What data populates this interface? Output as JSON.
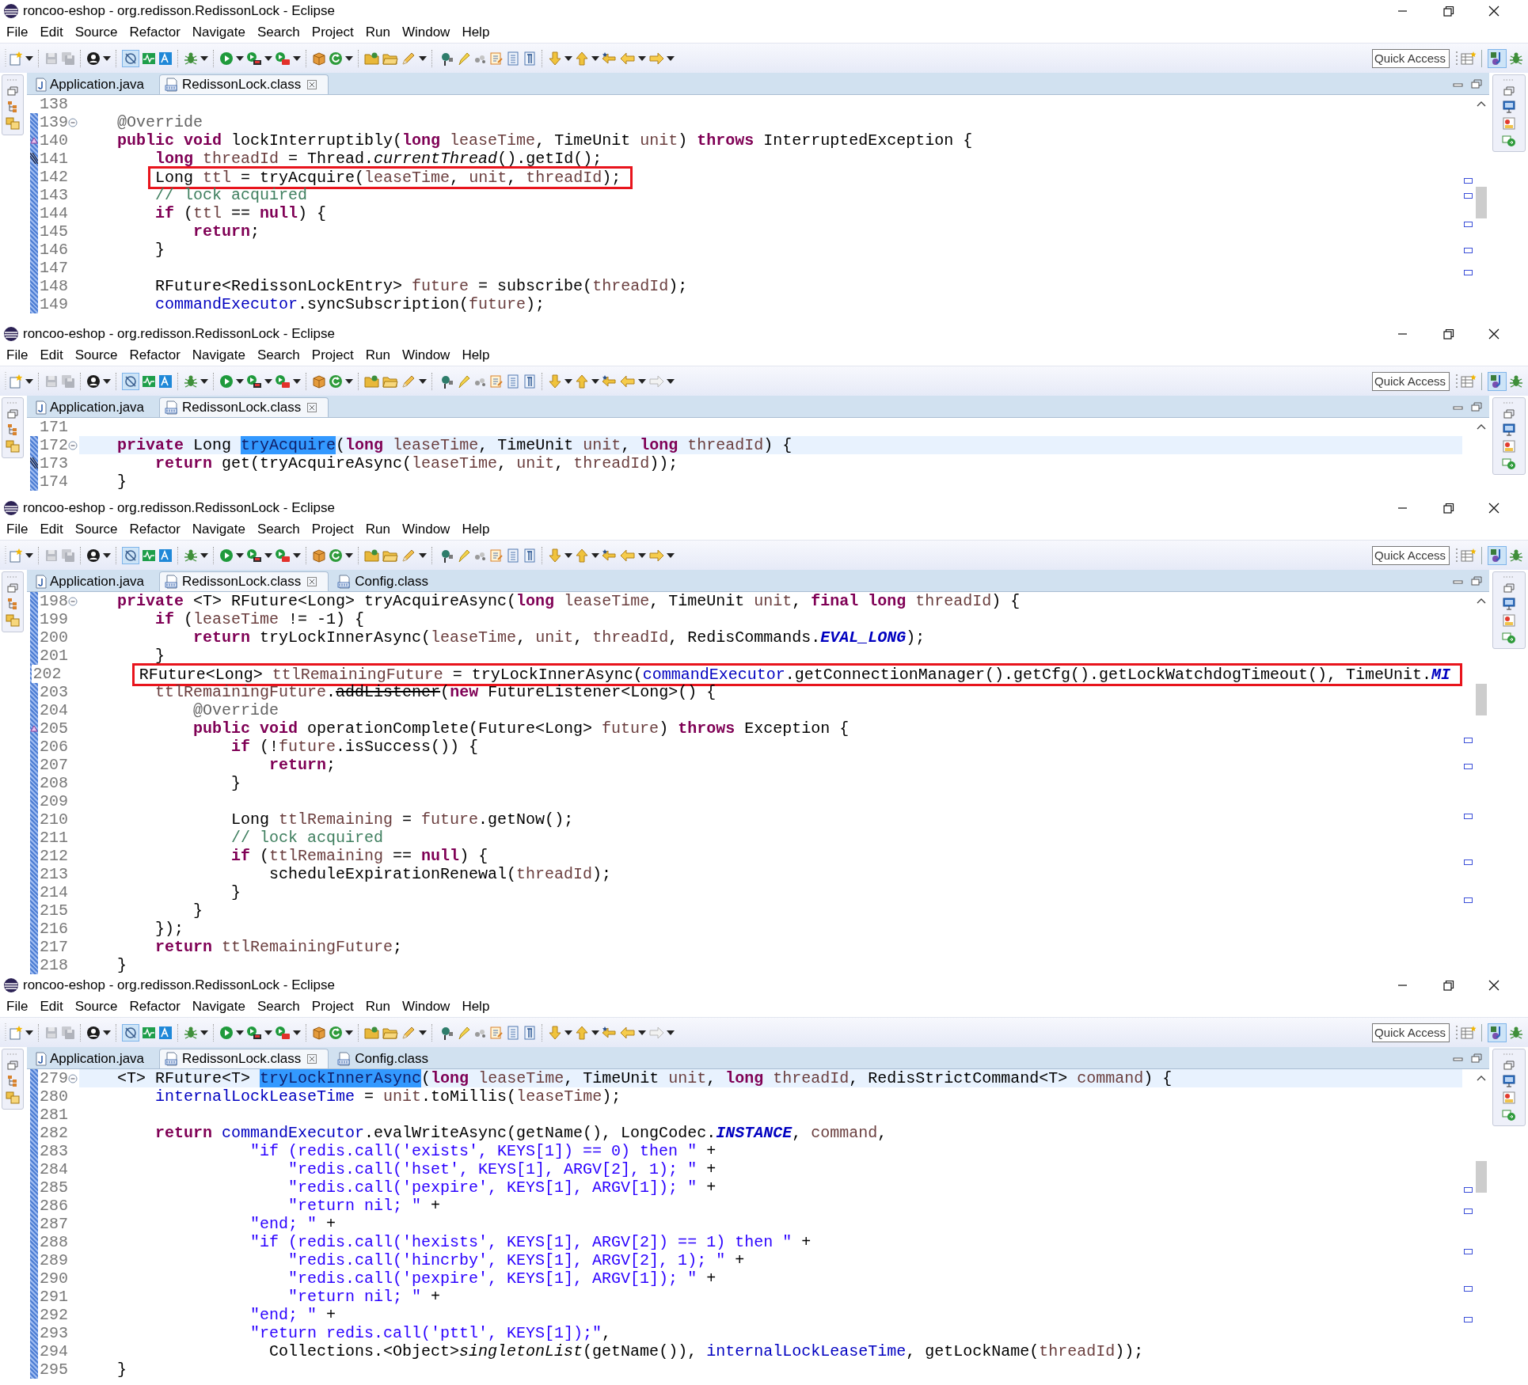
{
  "windows": [
    {
      "title": "roncoo-eshop - org.redisson.RedissonLock - Eclipse",
      "menu": [
        "File",
        "Edit",
        "Source",
        "Refactor",
        "Navigate",
        "Search",
        "Project",
        "Run",
        "Window",
        "Help"
      ],
      "toolbar": {
        "forward_enabled": true
      },
      "quick_access": {
        "placeholder": "Quick Access"
      },
      "tabs": [
        {
          "label": "Application.java",
          "kind": "java",
          "selected": false
        },
        {
          "label": "RedissonLock.class",
          "kind": "class",
          "selected": true
        }
      ],
      "lines": [
        {
          "number": "138",
          "in_range": false,
          "current": false,
          "fold": false,
          "override": false,
          "implements": false
        },
        {
          "number": "139",
          "in_range": true,
          "current": false,
          "boxed": false,
          "fold": true,
          "override": false,
          "implements": false,
          "tokens": [
            {
              "kind": "annotation",
              "text": "    @Override"
            }
          ]
        },
        {
          "number": "140",
          "in_range": true,
          "current": false,
          "boxed": false,
          "fold": false,
          "override": true,
          "implements": false,
          "tokens": [
            {
              "kind": "keyword",
              "text": "    public void"
            },
            {
              "kind": "plain",
              "text": " lockInterruptibly("
            },
            {
              "kind": "keyword",
              "text": "long"
            },
            {
              "kind": "local",
              "text": " leaseTime"
            },
            {
              "kind": "plain",
              "text": ", TimeUnit"
            },
            {
              "kind": "local",
              "text": " unit"
            },
            {
              "kind": "plain",
              "text": ") "
            },
            {
              "kind": "keyword",
              "text": "throws"
            },
            {
              "kind": "plain",
              "text": " InterruptedException {"
            }
          ]
        },
        {
          "number": "141",
          "in_range": true,
          "current": false,
          "boxed": false,
          "fold": false,
          "override": false,
          "implements": true,
          "tokens": [
            {
              "kind": "keyword",
              "text": "        long"
            },
            {
              "kind": "local",
              "text": " threadId"
            },
            {
              "kind": "plain",
              "text": " = Thread."
            },
            {
              "kind": "static",
              "text": "currentThread"
            },
            {
              "kind": "plain",
              "text": "().getId();"
            }
          ]
        },
        {
          "number": "142",
          "in_range": true,
          "current": false,
          "boxed": true,
          "fold": false,
          "override": false,
          "implements": false,
          "tokens": [
            {
              "kind": "plain",
              "text": "        Long"
            },
            {
              "kind": "local",
              "text": " ttl"
            },
            {
              "kind": "plain",
              "text": " = tryAcquire("
            },
            {
              "kind": "local",
              "text": "leaseTime"
            },
            {
              "kind": "plain",
              "text": ", "
            },
            {
              "kind": "local",
              "text": "unit"
            },
            {
              "kind": "plain",
              "text": ", "
            },
            {
              "kind": "local",
              "text": "threadId"
            },
            {
              "kind": "plain",
              "text": ");"
            }
          ]
        },
        {
          "number": "143",
          "in_range": true,
          "current": false,
          "boxed": false,
          "fold": false,
          "override": false,
          "implements": false,
          "tokens": [
            {
              "kind": "comment",
              "text": "        // lock acquired"
            }
          ]
        },
        {
          "number": "144",
          "in_range": true,
          "current": false,
          "boxed": false,
          "fold": false,
          "override": false,
          "implements": false,
          "tokens": [
            {
              "kind": "keyword",
              "text": "        if"
            },
            {
              "kind": "plain",
              "text": " ("
            },
            {
              "kind": "local",
              "text": "ttl"
            },
            {
              "kind": "plain",
              "text": " == "
            },
            {
              "kind": "keyword",
              "text": "null"
            },
            {
              "kind": "plain",
              "text": ") {"
            }
          ]
        },
        {
          "number": "145",
          "in_range": true,
          "current": false,
          "boxed": false,
          "fold": false,
          "override": false,
          "implements": false,
          "tokens": [
            {
              "kind": "keyword",
              "text": "            return"
            },
            {
              "kind": "plain",
              "text": ";"
            }
          ]
        },
        {
          "number": "146",
          "in_range": true,
          "current": false,
          "boxed": false,
          "fold": false,
          "override": false,
          "implements": false,
          "tokens": [
            {
              "kind": "plain",
              "text": "        }"
            }
          ]
        },
        {
          "number": "147",
          "in_range": true,
          "current": false,
          "fold": false,
          "override": false,
          "implements": false
        },
        {
          "number": "148",
          "in_range": true,
          "current": false,
          "boxed": false,
          "fold": false,
          "override": false,
          "implements": false,
          "tokens": [
            {
              "kind": "plain",
              "text": "        RFuture<RedissonLockEntry>"
            },
            {
              "kind": "local",
              "text": " future"
            },
            {
              "kind": "plain",
              "text": " = subscribe("
            },
            {
              "kind": "local",
              "text": "threadId"
            },
            {
              "kind": "plain",
              "text": ");"
            }
          ]
        },
        {
          "number": "149",
          "in_range": true,
          "current": false,
          "boxed": false,
          "fold": false,
          "override": false,
          "implements": false,
          "tokens": [
            {
              "kind": "field",
              "text": "        commandExecutor"
            },
            {
              "kind": "plain",
              "text": ".syncSubscription("
            },
            {
              "kind": "local",
              "text": "future"
            },
            {
              "kind": "plain",
              "text": ");"
            }
          ]
        }
      ]
    },
    {
      "title": "roncoo-eshop - org.redisson.RedissonLock - Eclipse",
      "menu": [
        "File",
        "Edit",
        "Source",
        "Refactor",
        "Navigate",
        "Search",
        "Project",
        "Run",
        "Window",
        "Help"
      ],
      "toolbar": {
        "forward_enabled": false
      },
      "quick_access": {
        "placeholder": "Quick Access"
      },
      "tabs": [
        {
          "label": "Application.java",
          "kind": "java",
          "selected": false
        },
        {
          "label": "RedissonLock.class",
          "kind": "class",
          "selected": true
        }
      ],
      "lines": [
        {
          "number": "171",
          "in_range": false,
          "current": false,
          "fold": false,
          "override": false,
          "implements": false
        },
        {
          "number": "172",
          "in_range": true,
          "current": true,
          "boxed": false,
          "fold": true,
          "override": false,
          "implements": false,
          "tokens": [
            {
              "kind": "keyword",
              "text": "    private"
            },
            {
              "kind": "plain",
              "text": " Long "
            },
            {
              "kind": "selection",
              "text": "tryAcquire"
            },
            {
              "kind": "plain",
              "text": "("
            },
            {
              "kind": "keyword",
              "text": "long"
            },
            {
              "kind": "local",
              "text": " leaseTime"
            },
            {
              "kind": "plain",
              "text": ", TimeUnit"
            },
            {
              "kind": "local",
              "text": " unit"
            },
            {
              "kind": "plain",
              "text": ", "
            },
            {
              "kind": "keyword",
              "text": "long"
            },
            {
              "kind": "local",
              "text": " threadId"
            },
            {
              "kind": "plain",
              "text": ") {"
            }
          ]
        },
        {
          "number": "173",
          "in_range": true,
          "current": false,
          "boxed": false,
          "fold": false,
          "override": false,
          "implements": true,
          "tokens": [
            {
              "kind": "keyword",
              "text": "        return"
            },
            {
              "kind": "plain",
              "text": " get(tryAcquireAsync("
            },
            {
              "kind": "local",
              "text": "leaseTime"
            },
            {
              "kind": "plain",
              "text": ", "
            },
            {
              "kind": "local",
              "text": "unit"
            },
            {
              "kind": "plain",
              "text": ", "
            },
            {
              "kind": "local",
              "text": "threadId"
            },
            {
              "kind": "plain",
              "text": "));"
            }
          ]
        },
        {
          "number": "174",
          "in_range": true,
          "current": false,
          "boxed": false,
          "fold": false,
          "override": false,
          "implements": false,
          "tokens": [
            {
              "kind": "plain",
              "text": "    }"
            }
          ]
        }
      ]
    },
    {
      "title": "roncoo-eshop - org.redisson.RedissonLock - Eclipse",
      "menu": [
        "File",
        "Edit",
        "Source",
        "Refactor",
        "Navigate",
        "Search",
        "Project",
        "Run",
        "Window",
        "Help"
      ],
      "toolbar": {
        "forward_enabled": true
      },
      "quick_access": {
        "placeholder": "Quick Access"
      },
      "tabs": [
        {
          "label": "Application.java",
          "kind": "java",
          "selected": false
        },
        {
          "label": "RedissonLock.class",
          "kind": "class",
          "selected": true
        },
        {
          "label": "Config.class",
          "kind": "class",
          "selected": false
        }
      ],
      "lines": [
        {
          "number": "198",
          "in_range": true,
          "current": false,
          "boxed": false,
          "fold": true,
          "override": false,
          "implements": false,
          "tokens": [
            {
              "kind": "keyword",
              "text": "    private"
            },
            {
              "kind": "plain",
              "text": " <T> RFuture<Long> tryAcquireAsync("
            },
            {
              "kind": "keyword",
              "text": "long"
            },
            {
              "kind": "local",
              "text": " leaseTime"
            },
            {
              "kind": "plain",
              "text": ", TimeUnit"
            },
            {
              "kind": "local",
              "text": " unit"
            },
            {
              "kind": "plain",
              "text": ", "
            },
            {
              "kind": "keyword",
              "text": "final long"
            },
            {
              "kind": "local",
              "text": " threadId"
            },
            {
              "kind": "plain",
              "text": ") {"
            }
          ]
        },
        {
          "number": "199",
          "in_range": true,
          "current": false,
          "boxed": false,
          "fold": false,
          "override": false,
          "implements": false,
          "tokens": [
            {
              "kind": "keyword",
              "text": "        if"
            },
            {
              "kind": "plain",
              "text": " ("
            },
            {
              "kind": "local",
              "text": "leaseTime"
            },
            {
              "kind": "plain",
              "text": " != -1) {"
            }
          ]
        },
        {
          "number": "200",
          "in_range": true,
          "current": false,
          "boxed": false,
          "fold": false,
          "override": false,
          "implements": false,
          "tokens": [
            {
              "kind": "keyword",
              "text": "            return"
            },
            {
              "kind": "plain",
              "text": " tryLockInnerAsync("
            },
            {
              "kind": "local",
              "text": "leaseTime"
            },
            {
              "kind": "plain",
              "text": ", "
            },
            {
              "kind": "local",
              "text": "unit"
            },
            {
              "kind": "plain",
              "text": ", "
            },
            {
              "kind": "local",
              "text": "threadId"
            },
            {
              "kind": "plain",
              "text": ", RedisCommands."
            },
            {
              "kind": "constant",
              "text": "EVAL_LONG"
            },
            {
              "kind": "plain",
              "text": ");"
            }
          ]
        },
        {
          "number": "201",
          "in_range": true,
          "current": false,
          "boxed": false,
          "fold": false,
          "override": false,
          "implements": false,
          "tokens": [
            {
              "kind": "plain",
              "text": "        }"
            }
          ]
        },
        {
          "number": "202",
          "in_range": true,
          "current": false,
          "boxed": true,
          "fold": false,
          "override": false,
          "implements": false,
          "tokens": [
            {
              "kind": "plain",
              "text": "        RFuture<Long>"
            },
            {
              "kind": "local",
              "text": " ttlRemainingFuture"
            },
            {
              "kind": "plain",
              "text": " = tryLockInnerAsync("
            },
            {
              "kind": "field",
              "text": "commandExecutor"
            },
            {
              "kind": "plain",
              "text": ".getConnectionManager().getCfg().getLockWatchdogTimeout(), TimeUnit."
            },
            {
              "kind": "constant",
              "text": "MI"
            }
          ]
        },
        {
          "number": "203",
          "in_range": true,
          "current": false,
          "boxed": false,
          "fold": false,
          "override": false,
          "implements": false,
          "tokens": [
            {
              "kind": "local",
              "text": "        ttlRemainingFuture"
            },
            {
              "kind": "plain",
              "text": "."
            },
            {
              "kind": "deprecated",
              "text": "addListener"
            },
            {
              "kind": "plain",
              "text": "("
            },
            {
              "kind": "keyword",
              "text": "new"
            },
            {
              "kind": "plain",
              "text": " FutureListener<Long>() {"
            }
          ]
        },
        {
          "number": "204",
          "in_range": true,
          "current": false,
          "boxed": false,
          "fold": false,
          "override": false,
          "implements": false,
          "tokens": [
            {
              "kind": "annotation",
              "text": "            @Override"
            }
          ]
        },
        {
          "number": "205",
          "in_range": true,
          "current": false,
          "boxed": false,
          "fold": false,
          "override": true,
          "implements": false,
          "tokens": [
            {
              "kind": "keyword",
              "text": "            public void"
            },
            {
              "kind": "plain",
              "text": " operationComplete(Future<Long>"
            },
            {
              "kind": "local",
              "text": " future"
            },
            {
              "kind": "plain",
              "text": ") "
            },
            {
              "kind": "keyword",
              "text": "throws"
            },
            {
              "kind": "plain",
              "text": " Exception {"
            }
          ]
        },
        {
          "number": "206",
          "in_range": true,
          "current": false,
          "boxed": false,
          "fold": false,
          "override": false,
          "implements": false,
          "tokens": [
            {
              "kind": "keyword",
              "text": "                if"
            },
            {
              "kind": "plain",
              "text": " (!"
            },
            {
              "kind": "local",
              "text": "future"
            },
            {
              "kind": "plain",
              "text": ".isSuccess()) {"
            }
          ]
        },
        {
          "number": "207",
          "in_range": true,
          "current": false,
          "boxed": false,
          "fold": false,
          "override": false,
          "implements": false,
          "tokens": [
            {
              "kind": "keyword",
              "text": "                    return"
            },
            {
              "kind": "plain",
              "text": ";"
            }
          ]
        },
        {
          "number": "208",
          "in_range": true,
          "current": false,
          "boxed": false,
          "fold": false,
          "override": false,
          "implements": false,
          "tokens": [
            {
              "kind": "plain",
              "text": "                }"
            }
          ]
        },
        {
          "number": "209",
          "in_range": true,
          "current": false,
          "fold": false,
          "override": false,
          "implements": false
        },
        {
          "number": "210",
          "in_range": true,
          "current": false,
          "boxed": false,
          "fold": false,
          "override": false,
          "implements": false,
          "tokens": [
            {
              "kind": "plain",
              "text": "                Long"
            },
            {
              "kind": "local",
              "text": " ttlRemaining"
            },
            {
              "kind": "plain",
              "text": " = "
            },
            {
              "kind": "local",
              "text": "future"
            },
            {
              "kind": "plain",
              "text": ".getNow();"
            }
          ]
        },
        {
          "number": "211",
          "in_range": true,
          "current": false,
          "boxed": false,
          "fold": false,
          "override": false,
          "implements": false,
          "tokens": [
            {
              "kind": "comment",
              "text": "                // lock acquired"
            }
          ]
        },
        {
          "number": "212",
          "in_range": true,
          "current": false,
          "boxed": false,
          "fold": false,
          "override": false,
          "implements": false,
          "tokens": [
            {
              "kind": "keyword",
              "text": "                if"
            },
            {
              "kind": "plain",
              "text": " ("
            },
            {
              "kind": "local",
              "text": "ttlRemaining"
            },
            {
              "kind": "plain",
              "text": " == "
            },
            {
              "kind": "keyword",
              "text": "null"
            },
            {
              "kind": "plain",
              "text": ") {"
            }
          ]
        },
        {
          "number": "213",
          "in_range": true,
          "current": false,
          "boxed": false,
          "fold": false,
          "override": false,
          "implements": false,
          "tokens": [
            {
              "kind": "plain",
              "text": "                    scheduleExpirationRenewal("
            },
            {
              "kind": "local",
              "text": "threadId"
            },
            {
              "kind": "plain",
              "text": ");"
            }
          ]
        },
        {
          "number": "214",
          "in_range": true,
          "current": false,
          "boxed": false,
          "fold": false,
          "override": false,
          "implements": false,
          "tokens": [
            {
              "kind": "plain",
              "text": "                }"
            }
          ]
        },
        {
          "number": "215",
          "in_range": true,
          "current": false,
          "boxed": false,
          "fold": false,
          "override": false,
          "implements": false,
          "tokens": [
            {
              "kind": "plain",
              "text": "            }"
            }
          ]
        },
        {
          "number": "216",
          "in_range": true,
          "current": false,
          "boxed": false,
          "fold": false,
          "override": false,
          "implements": false,
          "tokens": [
            {
              "kind": "plain",
              "text": "        });"
            }
          ]
        },
        {
          "number": "217",
          "in_range": true,
          "current": false,
          "boxed": false,
          "fold": false,
          "override": false,
          "implements": false,
          "tokens": [
            {
              "kind": "keyword",
              "text": "        return"
            },
            {
              "kind": "local",
              "text": " ttlRemainingFuture"
            },
            {
              "kind": "plain",
              "text": ";"
            }
          ]
        },
        {
          "number": "218",
          "in_range": true,
          "current": false,
          "boxed": false,
          "fold": false,
          "override": false,
          "implements": false,
          "tokens": [
            {
              "kind": "plain",
              "text": "    }"
            }
          ]
        }
      ]
    },
    {
      "title": "roncoo-eshop - org.redisson.RedissonLock - Eclipse",
      "menu": [
        "File",
        "Edit",
        "Source",
        "Refactor",
        "Navigate",
        "Search",
        "Project",
        "Run",
        "Window",
        "Help"
      ],
      "toolbar": {
        "forward_enabled": false
      },
      "quick_access": {
        "placeholder": "Quick Access"
      },
      "tabs": [
        {
          "label": "Application.java",
          "kind": "java",
          "selected": false
        },
        {
          "label": "RedissonLock.class",
          "kind": "class",
          "selected": true
        },
        {
          "label": "Config.class",
          "kind": "class",
          "selected": false
        }
      ],
      "lines": [
        {
          "number": "279",
          "in_range": true,
          "current": true,
          "boxed": false,
          "fold": true,
          "override": false,
          "implements": false,
          "tokens": [
            {
              "kind": "plain",
              "text": "    <T> RFuture<T> "
            },
            {
              "kind": "selection",
              "text": "tryLockInnerAsync"
            },
            {
              "kind": "plain",
              "text": "("
            },
            {
              "kind": "keyword",
              "text": "long"
            },
            {
              "kind": "local",
              "text": " leaseTime"
            },
            {
              "kind": "plain",
              "text": ", TimeUnit"
            },
            {
              "kind": "local",
              "text": " unit"
            },
            {
              "kind": "plain",
              "text": ", "
            },
            {
              "kind": "keyword",
              "text": "long"
            },
            {
              "kind": "local",
              "text": " threadId"
            },
            {
              "kind": "plain",
              "text": ", RedisStrictCommand<T>"
            },
            {
              "kind": "local",
              "text": " command"
            },
            {
              "kind": "plain",
              "text": ") {"
            }
          ]
        },
        {
          "number": "280",
          "in_range": true,
          "current": false,
          "boxed": false,
          "fold": false,
          "override": false,
          "implements": false,
          "tokens": [
            {
              "kind": "field",
              "text": "        internalLockLeaseTime"
            },
            {
              "kind": "plain",
              "text": " = "
            },
            {
              "kind": "local",
              "text": "unit"
            },
            {
              "kind": "plain",
              "text": ".toMillis("
            },
            {
              "kind": "local",
              "text": "leaseTime"
            },
            {
              "kind": "plain",
              "text": ");"
            }
          ]
        },
        {
          "number": "281",
          "in_range": true,
          "current": false,
          "fold": false,
          "override": false,
          "implements": false
        },
        {
          "number": "282",
          "in_range": true,
          "current": false,
          "boxed": false,
          "fold": false,
          "override": false,
          "implements": false,
          "tokens": [
            {
              "kind": "keyword",
              "text": "        return"
            },
            {
              "kind": "field",
              "text": " commandExecutor"
            },
            {
              "kind": "plain",
              "text": ".evalWriteAsync(getName(), LongCodec."
            },
            {
              "kind": "constant",
              "text": "INSTANCE"
            },
            {
              "kind": "plain",
              "text": ", "
            },
            {
              "kind": "local",
              "text": "command"
            },
            {
              "kind": "plain",
              "text": ","
            }
          ]
        },
        {
          "number": "283",
          "in_range": true,
          "current": false,
          "boxed": false,
          "fold": false,
          "override": false,
          "implements": false,
          "tokens": [
            {
              "kind": "string",
              "text": "                  \"if (redis.call('exists', KEYS[1]) == 0) then \""
            },
            {
              "kind": "plain",
              "text": " +"
            }
          ]
        },
        {
          "number": "284",
          "in_range": true,
          "current": false,
          "boxed": false,
          "fold": false,
          "override": false,
          "implements": false,
          "tokens": [
            {
              "kind": "string",
              "text": "                      \"redis.call('hset', KEYS[1], ARGV[2], 1); \""
            },
            {
              "kind": "plain",
              "text": " +"
            }
          ]
        },
        {
          "number": "285",
          "in_range": true,
          "current": false,
          "boxed": false,
          "fold": false,
          "override": false,
          "implements": false,
          "tokens": [
            {
              "kind": "string",
              "text": "                      \"redis.call('pexpire', KEYS[1], ARGV[1]); \""
            },
            {
              "kind": "plain",
              "text": " +"
            }
          ]
        },
        {
          "number": "286",
          "in_range": true,
          "current": false,
          "boxed": false,
          "fold": false,
          "override": false,
          "implements": false,
          "tokens": [
            {
              "kind": "string",
              "text": "                      \"return nil; \""
            },
            {
              "kind": "plain",
              "text": " +"
            }
          ]
        },
        {
          "number": "287",
          "in_range": true,
          "current": false,
          "boxed": false,
          "fold": false,
          "override": false,
          "implements": false,
          "tokens": [
            {
              "kind": "string",
              "text": "                  \"end; \""
            },
            {
              "kind": "plain",
              "text": " +"
            }
          ]
        },
        {
          "number": "288",
          "in_range": true,
          "current": false,
          "boxed": false,
          "fold": false,
          "override": false,
          "implements": false,
          "tokens": [
            {
              "kind": "string",
              "text": "                  \"if (redis.call('hexists', KEYS[1], ARGV[2]) == 1) then \""
            },
            {
              "kind": "plain",
              "text": " +"
            }
          ]
        },
        {
          "number": "289",
          "in_range": true,
          "current": false,
          "boxed": false,
          "fold": false,
          "override": false,
          "implements": false,
          "tokens": [
            {
              "kind": "string",
              "text": "                      \"redis.call('hincrby', KEYS[1], ARGV[2], 1); \""
            },
            {
              "kind": "plain",
              "text": " +"
            }
          ]
        },
        {
          "number": "290",
          "in_range": true,
          "current": false,
          "boxed": false,
          "fold": false,
          "override": false,
          "implements": false,
          "tokens": [
            {
              "kind": "string",
              "text": "                      \"redis.call('pexpire', KEYS[1], ARGV[1]); \""
            },
            {
              "kind": "plain",
              "text": " +"
            }
          ]
        },
        {
          "number": "291",
          "in_range": true,
          "current": false,
          "boxed": false,
          "fold": false,
          "override": false,
          "implements": false,
          "tokens": [
            {
              "kind": "string",
              "text": "                      \"return nil; \""
            },
            {
              "kind": "plain",
              "text": " +"
            }
          ]
        },
        {
          "number": "292",
          "in_range": true,
          "current": false,
          "boxed": false,
          "fold": false,
          "override": false,
          "implements": false,
          "tokens": [
            {
              "kind": "string",
              "text": "                  \"end; \""
            },
            {
              "kind": "plain",
              "text": " +"
            }
          ]
        },
        {
          "number": "293",
          "in_range": true,
          "current": false,
          "boxed": false,
          "fold": false,
          "override": false,
          "implements": false,
          "tokens": [
            {
              "kind": "string",
              "text": "                  \"return redis.call('pttl', KEYS[1]);\""
            },
            {
              "kind": "plain",
              "text": ","
            }
          ]
        },
        {
          "number": "294",
          "in_range": true,
          "current": false,
          "boxed": false,
          "fold": false,
          "override": false,
          "implements": false,
          "tokens": [
            {
              "kind": "plain",
              "text": "                    Collections.<Object>"
            },
            {
              "kind": "static",
              "text": "singletonList"
            },
            {
              "kind": "plain",
              "text": "(getName()), "
            },
            {
              "kind": "field",
              "text": "internalLockLeaseTime"
            },
            {
              "kind": "plain",
              "text": ", getLockName("
            },
            {
              "kind": "local",
              "text": "threadId"
            },
            {
              "kind": "plain",
              "text": "));"
            }
          ]
        },
        {
          "number": "295",
          "in_range": true,
          "current": false,
          "boxed": false,
          "fold": false,
          "override": false,
          "implements": false,
          "tokens": [
            {
              "kind": "plain",
              "text": "    }"
            }
          ]
        }
      ]
    }
  ]
}
